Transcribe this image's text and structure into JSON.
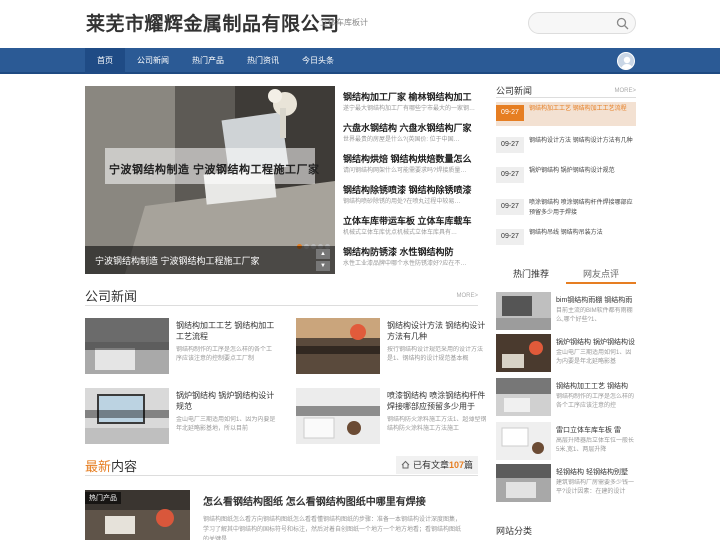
{
  "site": {
    "title": "莱芜市耀辉金属制品有限公司",
    "subtitle": "立体车库板计"
  },
  "nav": {
    "items": [
      "首页",
      "公司新闻",
      "热门产品",
      "热门资讯",
      "今日头条"
    ]
  },
  "slider": {
    "overlay_title": "宁波钢结构制造 宁波钢结构工程施工厂家",
    "caption": "宁波钢结构制造 宁波钢结构工程施工厂家",
    "up": "▲",
    "down": "▼"
  },
  "hot_list": [
    {
      "title": "钢结构加工厂家 榆林钢结构加工",
      "summary": "遂宁最大钢结构加工厂有哪些宁市最大的一家钢…"
    },
    {
      "title": "六盘水钢结构 六盘水钢结构厂家",
      "summary": "世界最贵的房屋是什么?(英国价: 位于中国…"
    },
    {
      "title": "钢结构烘焙 钢结构烘焙数量怎么",
      "summary": "请问钢结构网架什么可能需要求吗?焊接质量…"
    },
    {
      "title": "钢结构除锈喷漆 钢结构除锈喷漆",
      "summary": "钢结构喷砂除锈的用处?在喷丸过程中较易…"
    },
    {
      "title": "立体车库带运车板 立体车库载车",
      "summary": "机械式立体车库优点机械式立体车库具有…"
    },
    {
      "title": "钢结构防锈漆 水性钢结构防",
      "summary": "水性工业漆品牌中哪个水性防锈漆好?应在不…"
    }
  ],
  "company_news": {
    "title": "公司新闻",
    "more": "MORE>",
    "cards": [
      {
        "title": "钢结构加工工艺 钢结构加工工艺流程",
        "summary": "钢结构制作的工序是怎么样的各个工序应该注意的控制要点工厂制",
        "thumb_text": "钢结构加工工艺 钢结构加工工艺流程"
      },
      {
        "title": "钢结构设计方法 钢结构设计方法有几种",
        "summary": "按行钢结构设计规范采用的设计方法是1、钢结构的设计规范基本概",
        "thumb_text": "钢结构设计方法 钢结构设计方法有几种"
      },
      {
        "title": "锅炉钢结构 锅炉钢结构设计规范",
        "summary": "金山电厂三期适用如何1、因为内要是年北延略影基地，所以目前",
        "thumb_text": "锅炉钢结构 锅炉钢结构设计规范"
      },
      {
        "title": "喷漆钢结构 喷涂钢结构杆件焊接哪部应预留多少用于",
        "summary": "钢结构防火涂料施工方法1、超薄型钢结构防火涂料施工方法施工",
        "thumb_text": "喷漆钢结构 喷涂钢结构杆件焊接哪部应预留多少用于焊接"
      }
    ]
  },
  "latest": {
    "title_highlight": "最新",
    "title_rest": "内容",
    "count_prefix": "已有文章",
    "count": "107",
    "count_suffix": "篇"
  },
  "article": {
    "badge": "热门产品",
    "title": "怎么看钢结构图纸 怎么看钢结构图纸中哪里有焊接",
    "summary": "钢结构图纸怎么看方向钢结构图纸怎么看看懂钢结构图纸的步骤：准备一本钢结构设计深度图集，学习了解其中钢结构的国标符号和标注，然后对着自创图纸一个地方一个地方地看；看钢结构图纸的关键是"
  },
  "sidebar_news": {
    "title": "公司新闻",
    "more": "MORE>",
    "items": [
      {
        "date": "09-27",
        "text": "钢结构加工工艺 钢结构加工工艺流程"
      },
      {
        "date": "09-27",
        "text": "钢结构设计方法 钢结构设计方法有几种"
      },
      {
        "date": "09-27",
        "text": "锅炉钢结构 锅炉钢结构设计规范"
      },
      {
        "date": "09-27",
        "text": "喷涂钢结构 喷涂钢结构杆件焊接哪部应预留多少用于焊接"
      },
      {
        "date": "09-27",
        "text": "钢结构吊线 钢结构吊装方法"
      }
    ]
  },
  "sidebar_tabs": [
    "热门推荐",
    "网友点评"
  ],
  "sidebar_rec": [
    {
      "title": "bim钢结构雨棚 钢结构雨",
      "summary": "目前主流的BIM软件都有雨棚么,哪个好些?1、"
    },
    {
      "title": "锅炉钢结构 锅炉钢结构设",
      "summary": "金山电厂三期适用如何1、因为内要是年北延略影基"
    },
    {
      "title": "钢结构加工工艺 钢结构",
      "summary": "钢结构制作的工序是怎么样的各个工序应该注意的控"
    },
    {
      "title": "雷口立体车库车板 雷",
      "summary": "高层升降器后立体车位一般长5米,宽1、两层升降"
    },
    {
      "title": "轻钢结构 轻钢结构别墅",
      "summary": "建筑钢结构厂房需要多少钱一平?设计因素：在建的设计"
    }
  ],
  "sidebar_cat": "网站分类",
  "colors": {
    "nav": "#2b5a95",
    "accent": "#e67e22"
  }
}
